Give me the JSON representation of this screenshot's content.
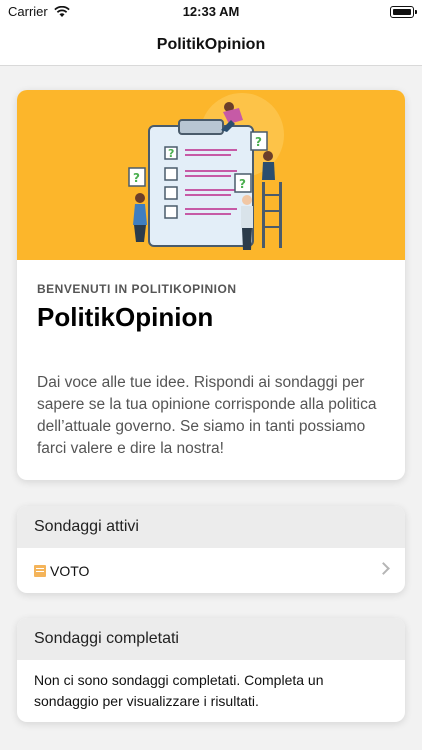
{
  "status": {
    "carrier": "Carrier",
    "time": "12:33 AM"
  },
  "nav": {
    "title": "PolitikOpinion"
  },
  "hero": {
    "eyebrow": "BENVENUTI IN POLITIKOPINION",
    "title": "PolitikOpinion",
    "body": "Dai voce alle tue idee. Rispondi ai sondaggi per sapere se la tua opinione corrisponde alla politica dell’attuale governo. Se siamo in tanti possiamo farci valere e dire la nostra!",
    "image_question_mark": "?"
  },
  "active_surveys": {
    "header": "Sondaggi attivi",
    "items": [
      {
        "label": "VOTO",
        "icon": "list-icon"
      }
    ]
  },
  "completed_surveys": {
    "header": "Sondaggi completati",
    "empty_message": "Non ci sono sondaggi completati. Completa un sondaggio per visualizzare i risultati."
  },
  "colors": {
    "hero_background": "#fcb62b",
    "section_header": "#ececec",
    "accent_green": "#4caf50"
  }
}
